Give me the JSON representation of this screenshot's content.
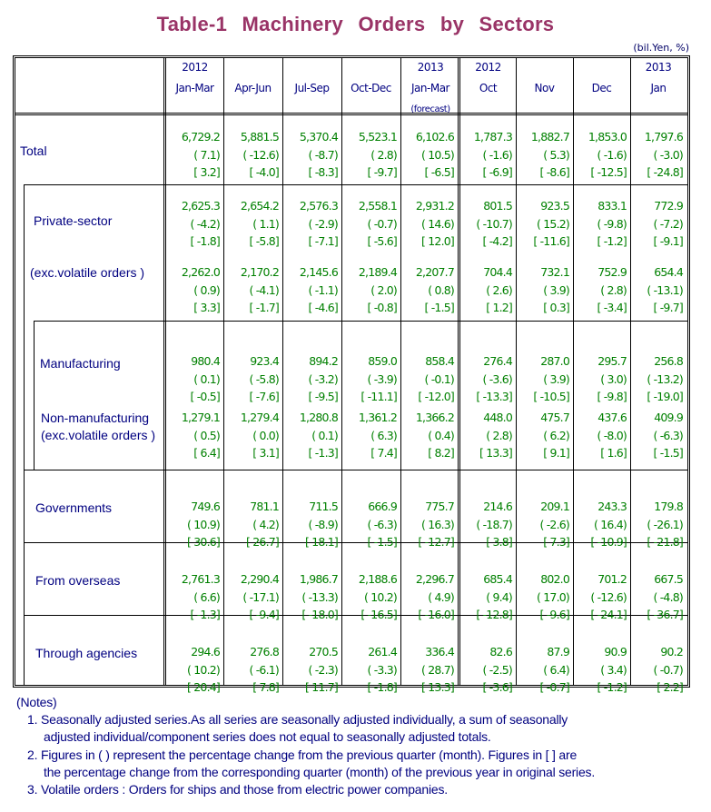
{
  "title": "Table-1  Machinery  Orders  by  Sectors",
  "unit": "(bil.Yen, %)",
  "columns": [
    {
      "year": "2012",
      "period": "Jan-Mar",
      "note": ""
    },
    {
      "year": "",
      "period": "Apr-Jun",
      "note": ""
    },
    {
      "year": "",
      "period": "Jul-Sep",
      "note": ""
    },
    {
      "year": "",
      "period": "Oct-Dec",
      "note": ""
    },
    {
      "year": "2013",
      "period": "Jan-Mar",
      "note": "(forecast)"
    },
    {
      "year": "2012",
      "period": "Oct",
      "note": ""
    },
    {
      "year": "",
      "period": "Nov",
      "note": ""
    },
    {
      "year": "",
      "period": "Dec",
      "note": ""
    },
    {
      "year": "2013",
      "period": "Jan",
      "note": ""
    }
  ],
  "rows": [
    {
      "label": "Total",
      "label2": "",
      "value": [
        "6,729.2",
        "5,881.5",
        "5,370.4",
        "5,523.1",
        "6,102.6",
        "1,787.3",
        "1,882.7",
        "1,853.0",
        "1,797.6"
      ],
      "qoq": [
        "( 7.1)",
        "( -12.6)",
        "( -8.7)",
        "( 2.8)",
        "( 10.5)",
        "( -1.6)",
        "( 5.3)",
        "( -1.6)",
        "( -3.0)"
      ],
      "yoy": [
        "[ 3.2]",
        "[ -4.0]",
        "[ -8.3]",
        "[ -9.7]",
        "[ -6.5]",
        "[ -6.9]",
        "[ -8.6]",
        "[ -12.5]",
        "[ -24.8]"
      ]
    },
    {
      "label": "Private-sector",
      "label2": "",
      "value": [
        "2,625.3",
        "2,654.2",
        "2,576.3",
        "2,558.1",
        "2,931.2",
        "801.5",
        "923.5",
        "833.1",
        "772.9"
      ],
      "qoq": [
        "( -4.2)",
        "( 1.1)",
        "( -2.9)",
        "( -0.7)",
        "( 14.6)",
        "( -10.7)",
        "( 15.2)",
        "( -9.8)",
        "( -7.2)"
      ],
      "yoy": [
        "[ -1.8]",
        "[ -5.8]",
        "[ -7.1]",
        "[ -5.6]",
        "[ 12.0]",
        "[ -4.2]",
        "[ -11.6]",
        "[ -1.2]",
        "[ -9.1]"
      ]
    },
    {
      "label": "(exc.volatile orders )",
      "label2": "",
      "value": [
        "2,262.0",
        "2,170.2",
        "2,145.6",
        "2,189.4",
        "2,207.7",
        "704.4",
        "732.1",
        "752.9",
        "654.4"
      ],
      "qoq": [
        "( 0.9)",
        "( -4.1)",
        "( -1.1)",
        "( 2.0)",
        "( 0.8)",
        "( 2.6)",
        "( 3.9)",
        "( 2.8)",
        "( -13.1)"
      ],
      "yoy": [
        "[ 3.3]",
        "[ -1.7]",
        "[ -4.6]",
        "[ -0.8]",
        "[ -1.5]",
        "[ 1.2]",
        "[ 0.3]",
        "[ -3.4]",
        "[ -9.7]"
      ]
    },
    {
      "label": "Manufacturing",
      "label2": "",
      "value": [
        "980.4",
        "923.4",
        "894.2",
        "859.0",
        "858.4",
        "276.4",
        "287.0",
        "295.7",
        "256.8"
      ],
      "qoq": [
        "( 0.1)",
        "( -5.8)",
        "( -3.2)",
        "( -3.9)",
        "( -0.1)",
        "( -3.6)",
        "( 3.9)",
        "( 3.0)",
        "( -13.2)"
      ],
      "yoy": [
        "[ -0.5]",
        "[ -7.6]",
        "[ -9.5]",
        "[ -11.1]",
        "[ -12.0]",
        "[ -13.3]",
        "[ -10.5]",
        "[ -9.8]",
        "[ -19.0]"
      ]
    },
    {
      "label": "Non-manufacturing",
      "label2": "(exc.volatile orders )",
      "value": [
        "1,279.1",
        "1,279.4",
        "1,280.8",
        "1,361.2",
        "1,366.2",
        "448.0",
        "475.7",
        "437.6",
        "409.9"
      ],
      "qoq": [
        "( 0.5)",
        "( 0.0)",
        "( 0.1)",
        "( 6.3)",
        "( 0.4)",
        "( 2.8)",
        "( 6.2)",
        "( -8.0)",
        "( -6.3)"
      ],
      "yoy": [
        "[ 6.4]",
        "[ 3.1]",
        "[ -1.3]",
        "[ 7.4]",
        "[ 8.2]",
        "[ 13.3]",
        "[ 9.1]",
        "[ 1.6]",
        "[ -1.5]"
      ]
    },
    {
      "label": "Governments",
      "label2": "",
      "value": [
        "749.6",
        "781.1",
        "711.5",
        "666.9",
        "775.7",
        "214.6",
        "209.1",
        "243.3",
        "179.8"
      ],
      "qoq": [
        "( 10.9)",
        "( 4.2)",
        "( -8.9)",
        "( -6.3)",
        "( 16.3)",
        "( -18.7)",
        "( -2.6)",
        "( 16.4)",
        "( -26.1)"
      ],
      "yoy": [
        "[ 30.6]",
        "[ 26.7]",
        "[ 18.1]",
        "[ -1.5]",
        "[ -12.7]",
        "[ 3.8]",
        "[ 7.3]",
        "[ -10.9]",
        "[ -21.8]"
      ]
    },
    {
      "label": "From overseas",
      "label2": "",
      "value": [
        "2,761.3",
        "2,290.4",
        "1,986.7",
        "2,188.6",
        "2,296.7",
        "685.4",
        "802.0",
        "701.2",
        "667.5"
      ],
      "qoq": [
        "( 6.6)",
        "( -17.1)",
        "( -13.3)",
        "( 10.2)",
        "( 4.9)",
        "( 9.4)",
        "( 17.0)",
        "( -12.6)",
        "( -4.8)"
      ],
      "yoy": [
        "[ -1.3]",
        "[ -9.4]",
        "[ -18.0]",
        "[ -16.5]",
        "[ -16.0]",
        "[ -12.8]",
        "[ -9.6]",
        "[ -24.1]",
        "[ -36.7]"
      ]
    },
    {
      "label": "Through agencies",
      "label2": "",
      "value": [
        "294.6",
        "276.8",
        "270.5",
        "261.4",
        "336.4",
        "82.6",
        "87.9",
        "90.9",
        "90.2"
      ],
      "qoq": [
        "( 10.2)",
        "( -6.1)",
        "( -2.3)",
        "( -3.3)",
        "( 28.7)",
        "( -2.5)",
        "( 6.4)",
        "( 3.4)",
        "( -0.7)"
      ],
      "yoy": [
        "[ 20.4]",
        "[ 7.8]",
        "[ 11.7]",
        "[ -1.8]",
        "[ 13.3]",
        "[ -3.6]",
        "[ -0.7]",
        "[ -1.2]",
        "[ 2.2]"
      ]
    }
  ],
  "notes": {
    "heading": "(Notes)",
    "items": [
      {
        "line1": "1. Seasonally adjusted series.As all series are seasonally adjusted individually, a sum of seasonally",
        "line2": "adjusted individual/component series does not equal to seasonally adjusted totals."
      },
      {
        "line1": "2. Figures in ( ) represent the percentage change from the previous quarter (month). Figures in [ ] are",
        "line2": "the percentage change from the corresponding quarter (month) of the previous year in original series."
      },
      {
        "line1": "3. Volatile orders : Orders for ships and those from electric power companies.",
        "line2": ""
      }
    ]
  },
  "colors": {
    "title": "#993366",
    "label": "#000080",
    "value": "#008000"
  }
}
